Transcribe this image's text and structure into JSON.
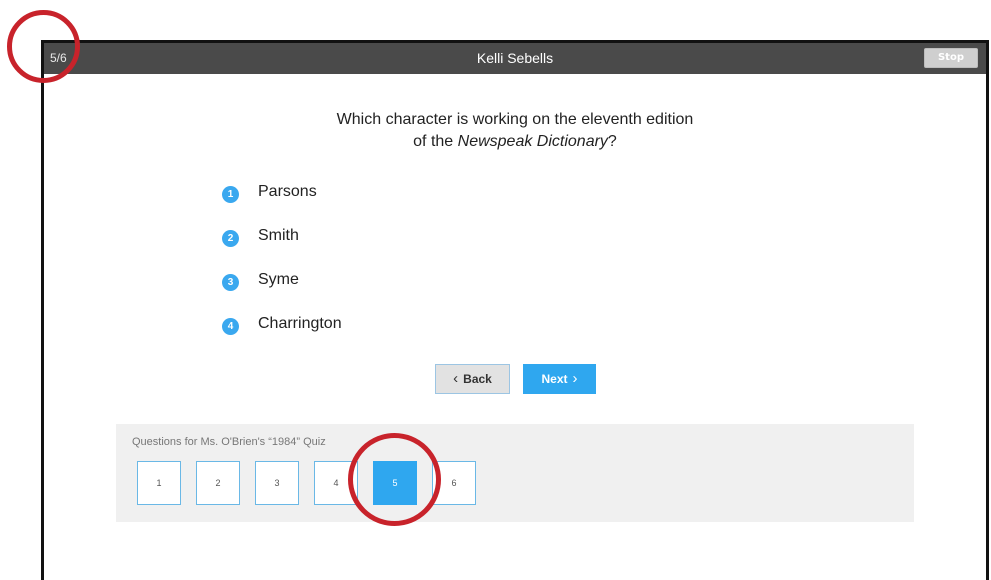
{
  "header": {
    "counter": "5/6",
    "user_name": "Kelli Sebells",
    "stop_label": "Stop"
  },
  "question": {
    "line1": "Which character is working on the eleventh edition",
    "line2_prefix": "of the ",
    "line2_italic": "Newspeak Dictionary",
    "line2_suffix": "?"
  },
  "answers": [
    {
      "number": "1",
      "label": "Parsons"
    },
    {
      "number": "2",
      "label": "Smith"
    },
    {
      "number": "3",
      "label": "Syme"
    },
    {
      "number": "4",
      "label": "Charrington"
    }
  ],
  "nav": {
    "back_label": "Back",
    "next_label": "Next",
    "back_icon": "chevron-left-icon",
    "next_icon": "chevron-right-icon"
  },
  "question_panel": {
    "title": "Questions for Ms. O'Brien's “1984” Quiz",
    "items": [
      "1",
      "2",
      "3",
      "4",
      "5",
      "6"
    ],
    "active": "5"
  },
  "colors": {
    "accent": "#2fa7ef",
    "topbar": "#4a4a4a",
    "annotation": "#c8232b"
  }
}
